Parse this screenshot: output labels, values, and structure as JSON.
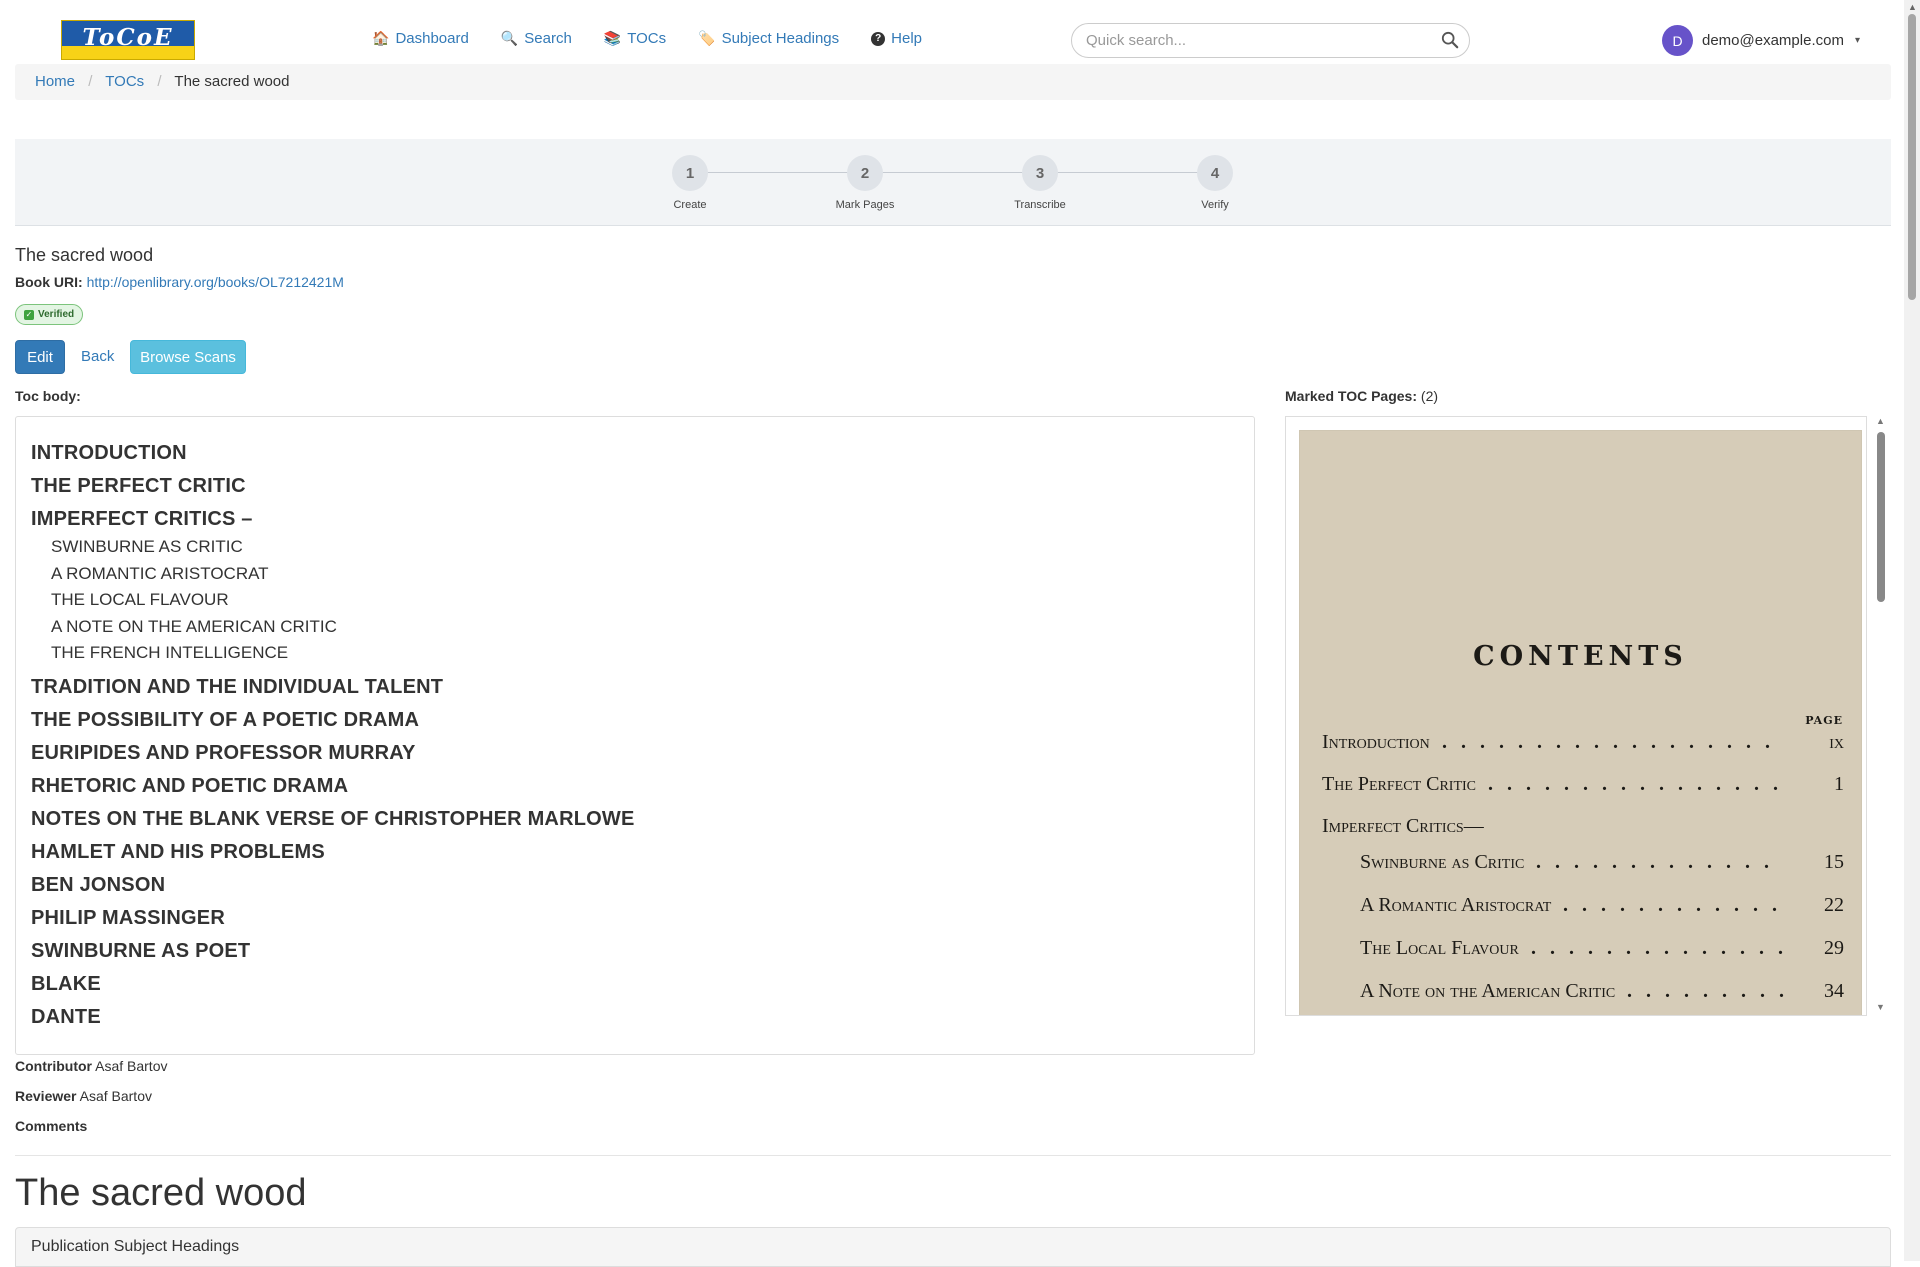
{
  "app": {
    "logo_text": "ToCoE"
  },
  "nav": {
    "items": [
      {
        "icon": "🏠",
        "label": "Dashboard"
      },
      {
        "icon": "🔍",
        "label": "Search"
      },
      {
        "icon": "📚",
        "label": "TOCs"
      },
      {
        "icon": "🏷️",
        "label": "Subject Headings"
      },
      {
        "icon": "?",
        "label": "Help"
      }
    ]
  },
  "quick_search": {
    "placeholder": "Quick search...",
    "value": ""
  },
  "user": {
    "initial": "D",
    "email": "demo@example.com",
    "caret": "▾"
  },
  "breadcrumb": {
    "items": [
      "Home",
      "TOCs",
      "The sacred wood"
    ],
    "separator": "/"
  },
  "stepper": {
    "steps": [
      {
        "number": "1",
        "label": "Create"
      },
      {
        "number": "2",
        "label": "Mark Pages"
      },
      {
        "number": "3",
        "label": "Transcribe"
      },
      {
        "number": "4",
        "label": "Verify"
      }
    ]
  },
  "book": {
    "title": "The sacred wood",
    "uri_label": "Book URI:",
    "uri": "http://openlibrary.org/books/OL7212421M",
    "status_badge": "Verified"
  },
  "actions": {
    "edit": "Edit",
    "back": "Back",
    "browse_scans": "Browse Scans"
  },
  "toc": {
    "label": "Toc body:",
    "entries": [
      {
        "text": "INTRODUCTION",
        "level": 1
      },
      {
        "text": "THE PERFECT CRITIC",
        "level": 1
      },
      {
        "text": "IMPERFECT CRITICS –",
        "level": 1
      },
      {
        "text": "SWINBURNE AS CRITIC",
        "level": 2
      },
      {
        "text": "A ROMANTIC ARISTOCRAT",
        "level": 2
      },
      {
        "text": "THE LOCAL FLAVOUR",
        "level": 2
      },
      {
        "text": "A NOTE ON THE AMERICAN CRITIC",
        "level": 2
      },
      {
        "text": "THE FRENCH INTELLIGENCE",
        "level": 2
      },
      {
        "text": "TRADITION AND THE INDIVIDUAL TALENT",
        "level": 1
      },
      {
        "text": "THE POSSIBILITY OF A POETIC DRAMA",
        "level": 1
      },
      {
        "text": "EURIPIDES AND PROFESSOR MURRAY",
        "level": 1
      },
      {
        "text": "RHETORIC AND POETIC DRAMA",
        "level": 1
      },
      {
        "text": "NOTES ON THE BLANK VERSE OF CHRISTOPHER MARLOWE",
        "level": 1
      },
      {
        "text": "HAMLET AND HIS PROBLEMS",
        "level": 1
      },
      {
        "text": "BEN JONSON",
        "level": 1
      },
      {
        "text": "PHILIP MASSINGER",
        "level": 1
      },
      {
        "text": "SWINBURNE AS POET",
        "level": 1
      },
      {
        "text": "BLAKE",
        "level": 1
      },
      {
        "text": "DANTE",
        "level": 1
      }
    ]
  },
  "marked_pages": {
    "label": "Marked TOC Pages:",
    "count": "(2)",
    "scan": {
      "heading": "CONTENTS",
      "page_header": "PAGE",
      "rows": [
        {
          "title": "Introduction",
          "page": "ix",
          "indent": false
        },
        {
          "title": "The Perfect Critic",
          "page": "1",
          "indent": false
        },
        {
          "title": "Imperfect Critics—",
          "page": "",
          "indent": false
        },
        {
          "title": "Swinburne as Critic",
          "page": "15",
          "indent": true
        },
        {
          "title": "A Romantic Aristocrat",
          "page": "22",
          "indent": true
        },
        {
          "title": "The Local Flavour",
          "page": "29",
          "indent": true
        },
        {
          "title": "A Note on the American Critic",
          "page": "34",
          "indent": true
        }
      ]
    }
  },
  "meta": {
    "contributor_label": "Contributor",
    "contributor": "Asaf Bartov",
    "reviewer_label": "Reviewer",
    "reviewer": "Asaf Bartov",
    "comments_label": "Comments"
  },
  "section": {
    "title": "The sacred wood",
    "panel_heading": "Publication Subject Headings"
  }
}
